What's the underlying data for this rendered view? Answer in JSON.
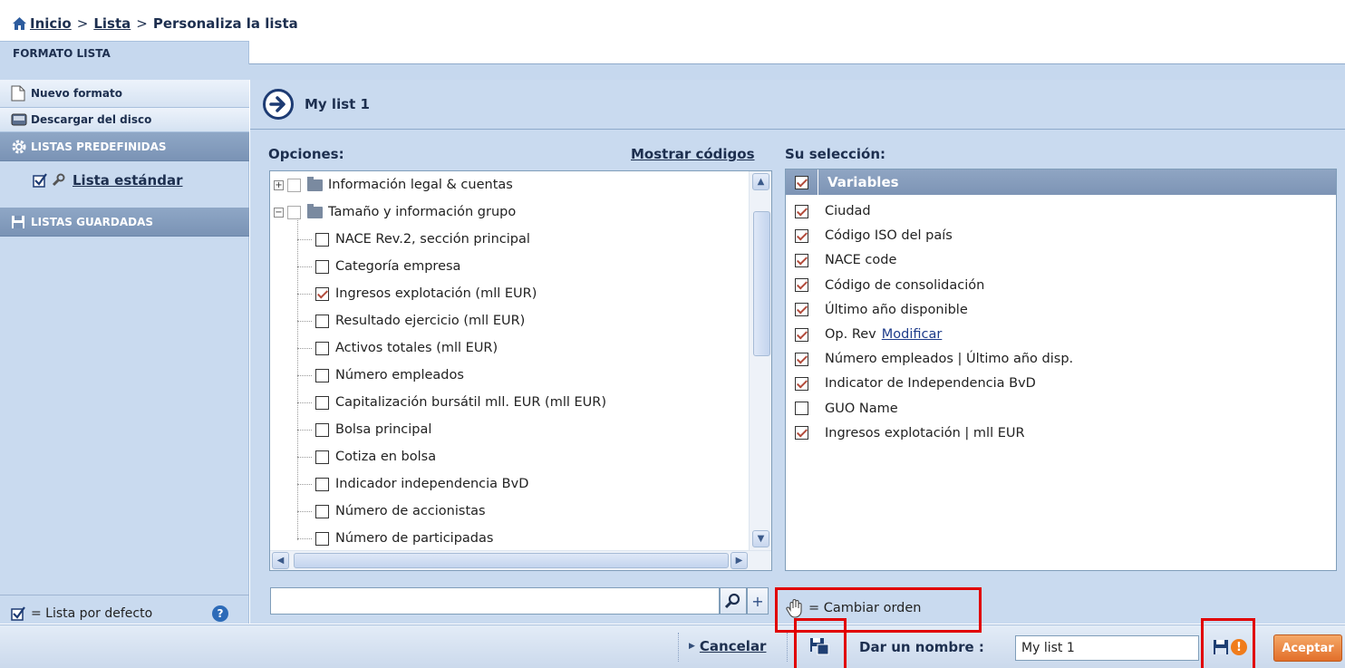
{
  "breadcrumb": {
    "home": "Inicio",
    "sep1": ">",
    "lista": "Lista",
    "sep2": ">",
    "current": "Personaliza la lista"
  },
  "tab": {
    "label": "FORMATO LISTA"
  },
  "sidebar": {
    "new_format": "Nuevo formato",
    "download": "Descargar del disco",
    "predefined": "LISTAS PREDEFINIDAS",
    "standard_list": "Lista estándar",
    "saved": "LISTAS GUARDADAS",
    "default_legend": "= Lista por defecto",
    "help": "?"
  },
  "main": {
    "list_title": "My list 1",
    "options_label": "Opciones:",
    "show_codes": "Mostrar códigos",
    "selection_label": "Su selección:",
    "selection_header": "Variables"
  },
  "tree": [
    {
      "label": "Información legal & cuentas",
      "checked": false,
      "folder": true,
      "expand": "+"
    },
    {
      "label": "Tamaño y información grupo",
      "checked": false,
      "folder": true,
      "expand": "−"
    },
    {
      "label": "NACE Rev.2, sección principal",
      "checked": false
    },
    {
      "label": "Categoría empresa",
      "checked": false
    },
    {
      "label": "Ingresos explotación (mll EUR)",
      "checked": true
    },
    {
      "label": "Resultado ejercicio (mll EUR)",
      "checked": false
    },
    {
      "label": "Activos totales (mll EUR)",
      "checked": false
    },
    {
      "label": "Número empleados",
      "checked": false
    },
    {
      "label": "Capitalización bursátil mll. EUR (mll EUR)",
      "checked": false
    },
    {
      "label": "Bolsa principal",
      "checked": false
    },
    {
      "label": "Cotiza en bolsa",
      "checked": false
    },
    {
      "label": "Indicador independencia BvD",
      "checked": false
    },
    {
      "label": "Número de accionistas",
      "checked": false
    },
    {
      "label": "Número de participadas",
      "checked": false
    }
  ],
  "selection": [
    {
      "label": "Ciudad",
      "checked": true
    },
    {
      "label": "Código ISO del país",
      "checked": true
    },
    {
      "label": "NACE code",
      "checked": true
    },
    {
      "label": "Código de consolidación",
      "checked": true
    },
    {
      "label": "Último año disponible",
      "checked": true
    },
    {
      "label": "Op. Rev",
      "checked": true,
      "link": "Modificar"
    },
    {
      "label": "Número empleados | Último año disp.",
      "checked": true
    },
    {
      "label": "Indicator de Independencia BvD",
      "checked": true
    },
    {
      "label": "GUO Name",
      "checked": false
    },
    {
      "label": "Ingresos explotación | mll EUR",
      "checked": true
    }
  ],
  "search": {
    "value": "",
    "add": "+"
  },
  "order_legend": "= Cambiar orden",
  "bottom": {
    "cancel": "Cancelar",
    "name_label": "Dar un nombre :",
    "name_value": "My list 1",
    "accept": "Aceptar",
    "warn": "!"
  },
  "colors": {
    "accent": "#1d2f4f",
    "panel_bg": "#c9daef",
    "highlight_box": "#e10000",
    "accept_btn": "#e26f2a"
  },
  "icons": [
    "home-icon",
    "new-doc-icon",
    "disk-icon",
    "gear-icon",
    "check-icon",
    "wrench-icon",
    "floppy-icon",
    "arrow-right-icon",
    "folder-icon",
    "search-icon",
    "hand-icon",
    "save-as-icon",
    "warning-icon",
    "help-icon"
  ]
}
